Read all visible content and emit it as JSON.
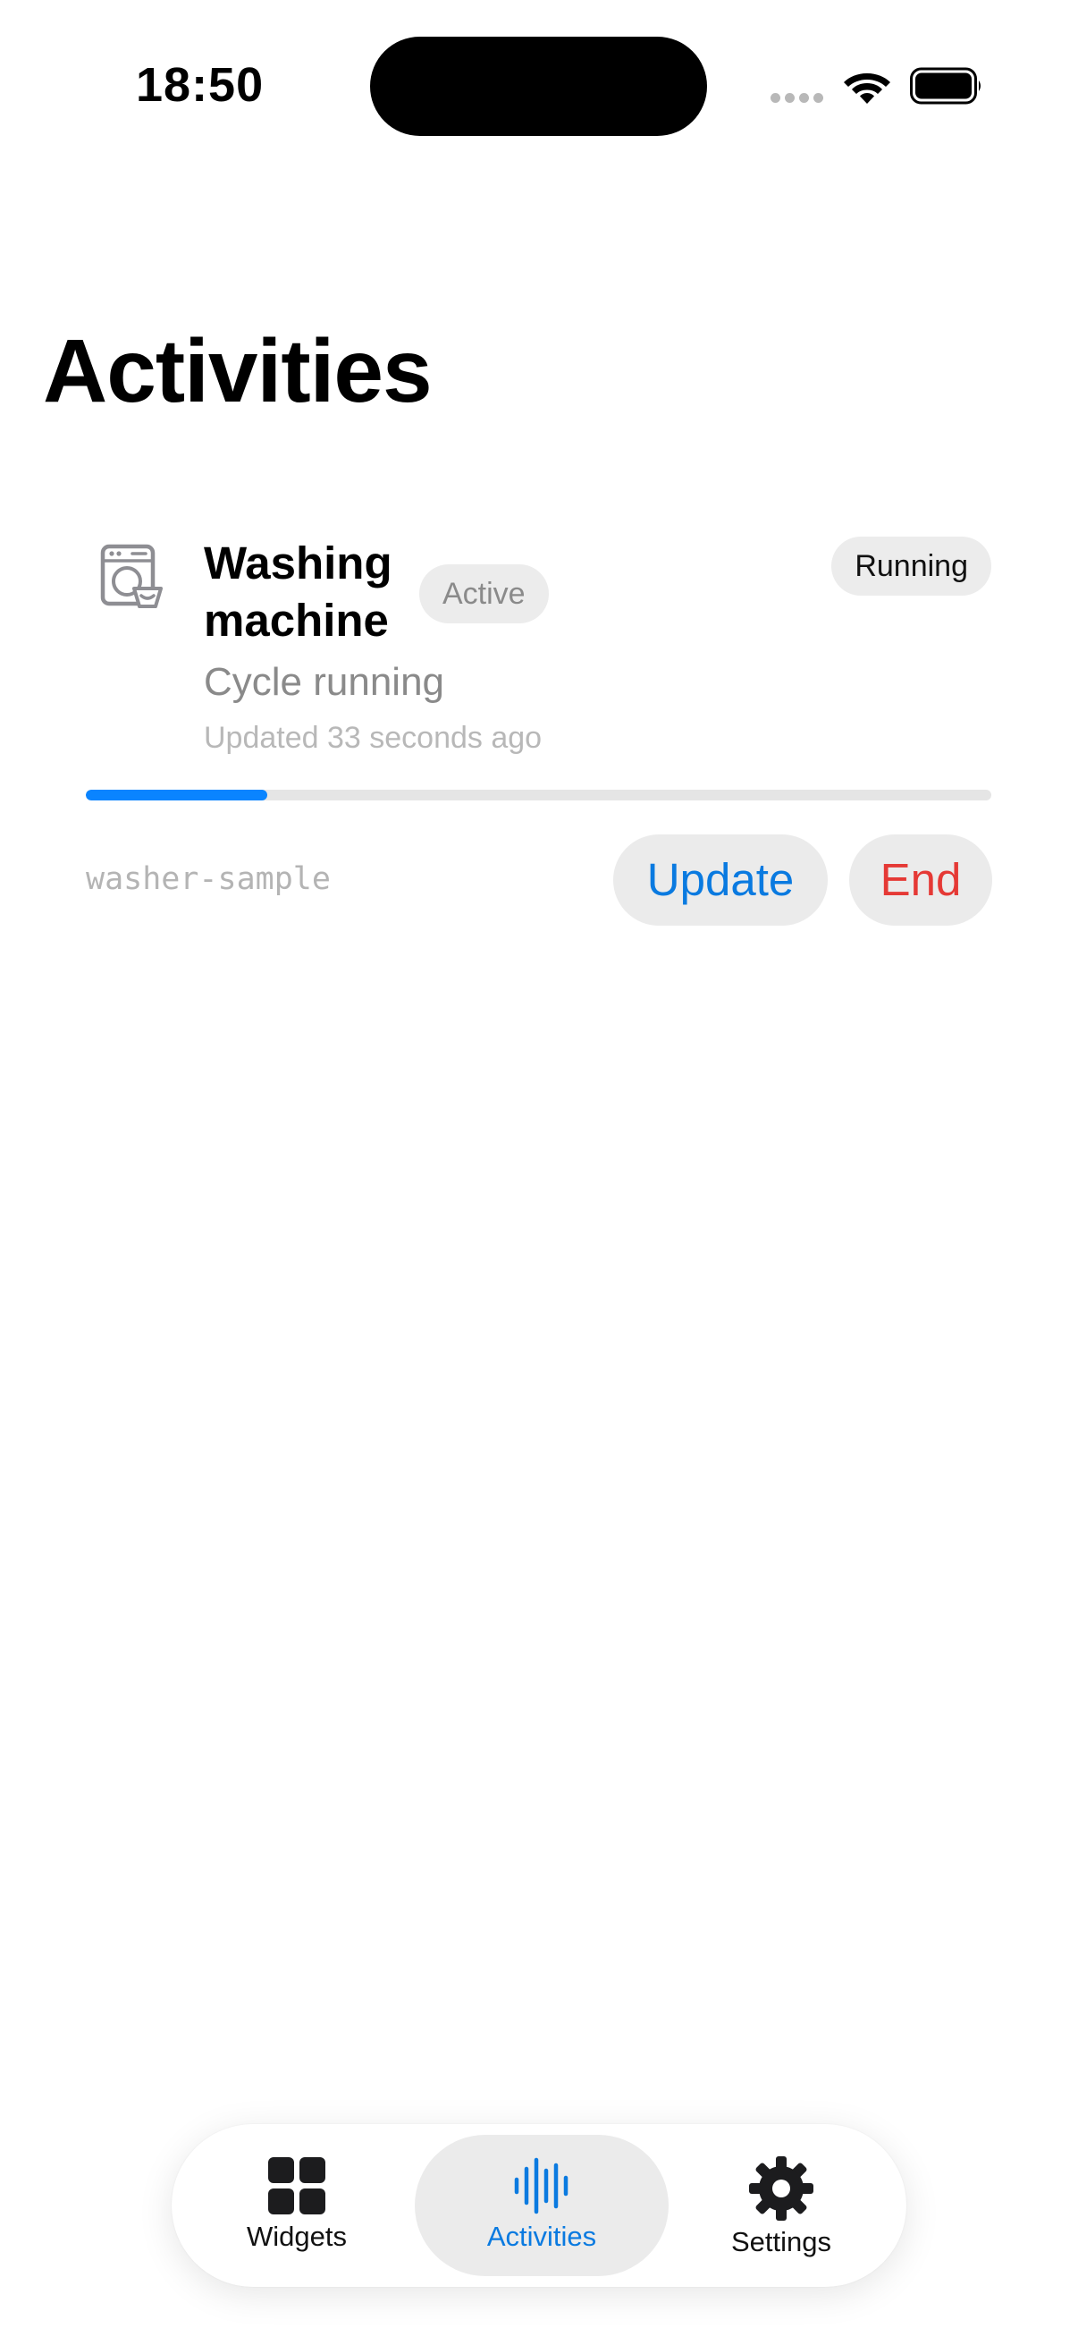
{
  "status_bar": {
    "time": "18:50"
  },
  "page": {
    "title": "Activities"
  },
  "activity": {
    "name": "Washing machine",
    "badge": "Active",
    "state": "Running",
    "status": "Cycle running",
    "updated": "Updated 33 seconds ago",
    "progress": 0.2,
    "id": "washer-sample",
    "update_label": "Update",
    "end_label": "End",
    "icon": "washer-icon"
  },
  "tab_bar": {
    "items": [
      {
        "label": "Widgets",
        "icon": "grid-icon"
      },
      {
        "label": "Activities",
        "icon": "waveform-icon",
        "selected": true
      },
      {
        "label": "Settings",
        "icon": "gear-icon"
      }
    ]
  },
  "colors": {
    "accent": "#0a7ae0",
    "progress": "#0a84ff",
    "destructive": "#e53935"
  }
}
